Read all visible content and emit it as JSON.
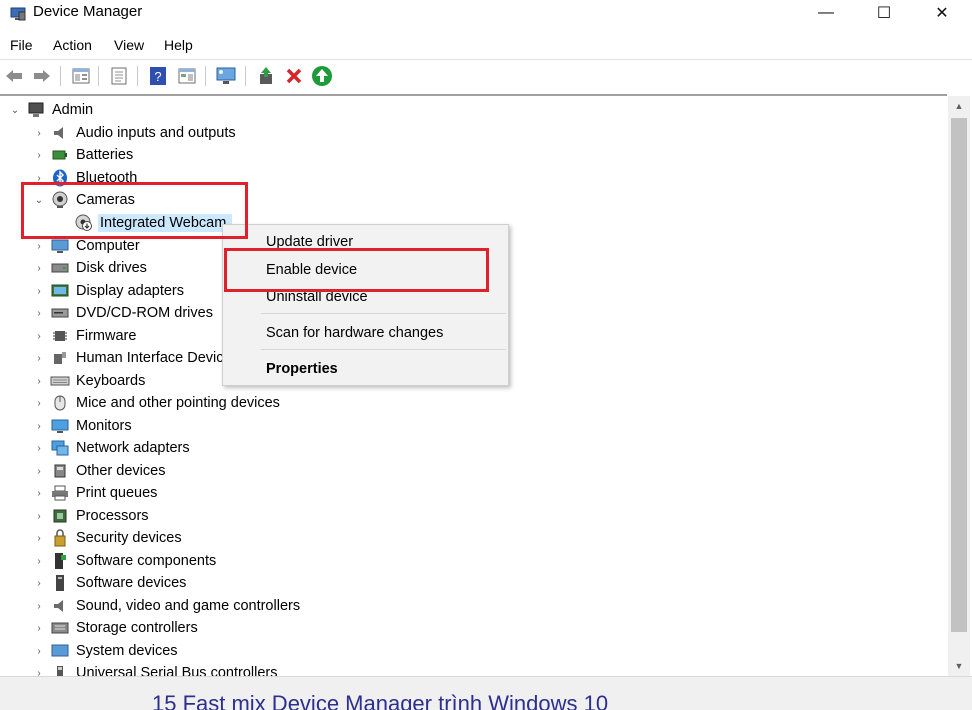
{
  "window": {
    "title": "Device Manager",
    "minimize": "—",
    "maximize": "☐",
    "close": "✕"
  },
  "menu": [
    "File",
    "Action",
    "View",
    "Help"
  ],
  "toolbar": [
    "back-icon",
    "forward-icon",
    "properties-icon",
    "list-icon",
    "help-icon",
    "view-icon",
    "scan-icon",
    "update-driver-icon",
    "uninstall-icon",
    "enable-icon"
  ],
  "tree": {
    "root": "Admin",
    "categories": [
      "Audio inputs and outputs",
      "Batteries",
      "Bluetooth",
      "Cameras",
      "Computer",
      "Disk drives",
      "Display adapters",
      "DVD/CD-ROM drives",
      "Firmware",
      "Human Interface Devices",
      "Keyboards",
      "Mice and other pointing devices",
      "Monitors",
      "Network adapters",
      "Other devices",
      "Print queues",
      "Processors",
      "Security devices",
      "Software components",
      "Software devices",
      "Sound, video and game controllers",
      "Storage controllers",
      "System devices",
      "Universal Serial Bus controllers"
    ],
    "camera_child": "Integrated Webcam"
  },
  "context_menu": {
    "update": "Update driver",
    "enable": "Enable device",
    "uninstall": "Uninstall device",
    "scan": "Scan for hardware changes",
    "properties": "Properties"
  },
  "status_caption": "15 Fast mix Device Manager trình Windows 10",
  "colors": {
    "highlight": "#e0202a",
    "selection": "#cce8ff"
  }
}
